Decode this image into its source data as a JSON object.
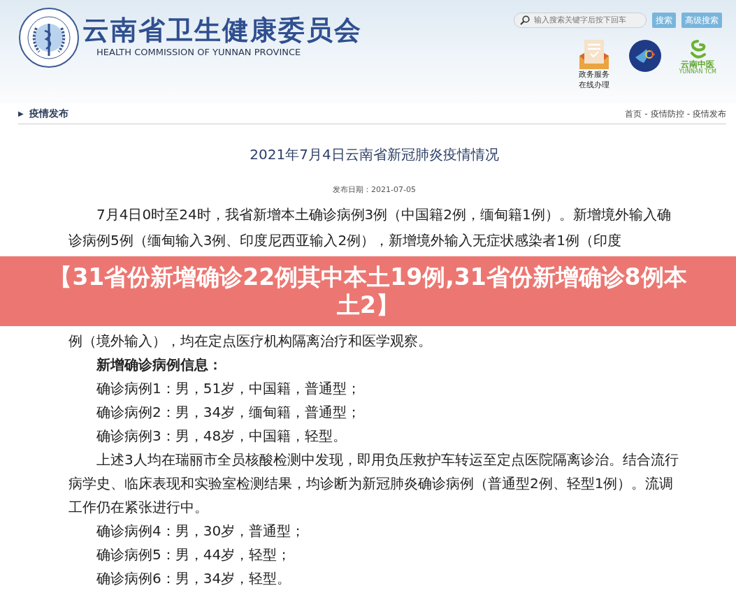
{
  "header": {
    "title": "云南省卫生健康委员会",
    "subtitle": "HEALTH COMMISSION OF YUNNAN PROVINCE",
    "search": {
      "placeholder": "输入搜索关键字后按下回车"
    },
    "buttons": [
      "搜索",
      "高级搜索"
    ],
    "shortcuts": [
      {
        "kind": "service",
        "label": "政务服务在线办理"
      },
      {
        "kind": "emblem"
      },
      {
        "kind": "tcm",
        "label": "云南中医",
        "sublabel": "YUNNAN TCM"
      }
    ]
  },
  "section": {
    "marker": "▶",
    "title": "疫情发布",
    "breadcrumb": [
      "首页",
      "疫情防控",
      "疫情发布"
    ],
    "separator": "-"
  },
  "article": {
    "title": "2021年7月4日云南省新冠肺炎疫情情况",
    "date": "发布日期：2021-07-05",
    "paragraphs_before": [
      {
        "text": "7月4日0时至24时，我省新增本土确诊病例3例（中国籍2例，缅甸籍1例）。新增境外输入确诊病例5例（缅甸输入3例、印度尼西亚输入2例），新增境外输入无症状感染者1例（印度"
      }
    ],
    "paragraphs_after": [
      {
        "kind": "continuation",
        "text": "例（境外输入），均在定点医疗机构隔离治疗和医学观察。"
      },
      {
        "kind": "heading",
        "text": "新增确诊病例信息："
      },
      {
        "kind": "text",
        "text": "确诊病例1：男，51岁，中国籍，普通型；"
      },
      {
        "kind": "text",
        "text": "确诊病例2：男，34岁，缅甸籍，普通型；"
      },
      {
        "kind": "text",
        "text": "确诊病例3：男，48岁，中国籍，轻型。"
      },
      {
        "kind": "text",
        "text": "上述3人均在瑞丽市全员核酸检测中发现，即用负压救护车转运至定点医院隔离诊治。结合流行病学史、临床表现和实验室检测结果，均诊断为新冠肺炎确诊病例（普通型2例、轻型1例）。流调工作仍在紧张进行中。"
      },
      {
        "kind": "text",
        "text": "确诊病例4：男，30岁，普通型；"
      },
      {
        "kind": "text",
        "text": "确诊病例5：男，44岁，轻型；"
      },
      {
        "kind": "text",
        "text": "确诊病例6：男，34岁，轻型。"
      }
    ]
  },
  "banner": {
    "text": "【31省份新增确诊22例其中本土19例,31省份新增确诊8例本土2】"
  }
}
